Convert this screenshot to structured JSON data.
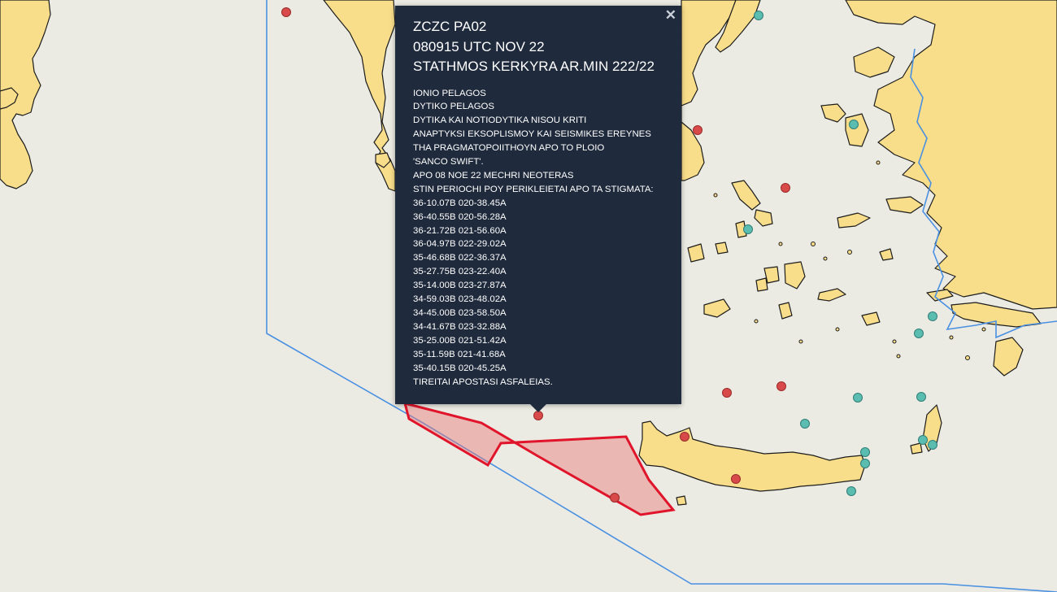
{
  "colors": {
    "sea": "#ebebe3",
    "land": "#f8dd8a",
    "popup_bg": "#1f2a3c",
    "fir_boundary": "#4a90e2",
    "danger_area_stroke": "#e0142a",
    "marker_red": "#d84a4a",
    "marker_teal": "#5bbcb0"
  },
  "popup": {
    "close_icon": "close-icon",
    "header": [
      "ZCZC PA02",
      "080915 UTC NOV 22",
      "STATHMOS KERKYRA AR.MIN 222/22"
    ],
    "body": [
      "IONIO PELAGOS",
      "DYTIKO PELAGOS",
      "DYTIKA KAI NOTIODYTIKA NISOU KRITI",
      "ANAPTYKSI EKSOPLISMOY KAI SEISMIKES EREYNES",
      "THA PRAGMATOPOIITHOYN APO TO PLOIO",
      "'SANCO SWIFT'.",
      "APO 08 NOE 22 MECHRI NEOTERAS",
      "STIN PERIOCHI POY PERIKLEIETAI APO TA STIGMATA:",
      "36-10.07B 020-38.45A",
      "36-40.55B 020-56.28A",
      "36-21.72B 021-56.60A",
      "36-04.97B 022-29.02A",
      "35-46.68B 022-36.37A",
      "35-27.75B 023-22.40A",
      "35-14.00B 023-27.87A",
      "34-59.03B 023-48.02A",
      "34-45.00B 023-58.50A",
      "34-41.67B 023-32.88A",
      "35-25.00B 021-51.42A",
      "35-11.59B 021-41.68A",
      "35-40.15B 020-45.25A",
      "TIREITAI APOSTASI ASFALEIAS."
    ]
  }
}
